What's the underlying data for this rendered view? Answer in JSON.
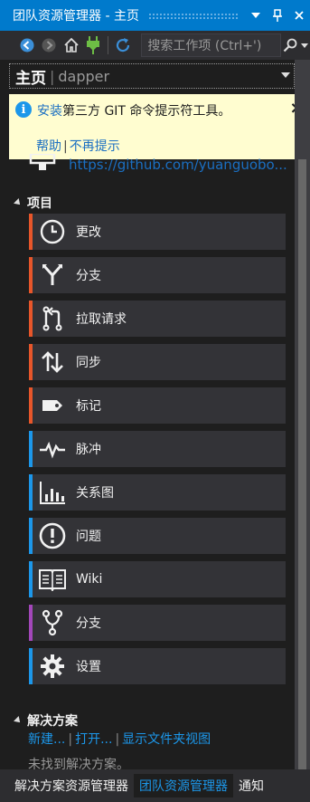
{
  "window": {
    "title": "团队资源管理器 - 主页",
    "dropdown_icon": "window-menu-icon",
    "pin_icon": "pin-icon",
    "close_icon": "close-icon"
  },
  "toolbar": {
    "search_placeholder": "搜索工作项 (Ctrl+')",
    "buttons": [
      "back-icon",
      "forward-icon",
      "home-icon",
      "connect-icon",
      "refresh-icon",
      "search-icon"
    ]
  },
  "page": {
    "title": "主页",
    "separator": "|",
    "repository": "dapper"
  },
  "infobar": {
    "link_install": "安装",
    "message": "第三方 GIT 命令提示符工具。",
    "close": "×",
    "help": "帮助",
    "separator": "|",
    "dont_show": "不再提示"
  },
  "connect": {
    "url": "https://github.com/yuanguobo..."
  },
  "project_section": {
    "title": "项目",
    "tiles": [
      {
        "label": "更改",
        "icon": "clock-icon",
        "color": "#e8562a"
      },
      {
        "label": "分支",
        "icon": "branch-icon",
        "color": "#e8562a"
      },
      {
        "label": "拉取请求",
        "icon": "pull-request-icon",
        "color": "#e8562a"
      },
      {
        "label": "同步",
        "icon": "sync-arrows-icon",
        "color": "#e8562a"
      },
      {
        "label": "标记",
        "icon": "tag-icon",
        "color": "#e8562a"
      },
      {
        "label": "脉冲",
        "icon": "pulse-icon",
        "color": "#1c97ea"
      },
      {
        "label": "关系图",
        "icon": "chart-icon",
        "color": "#1c97ea"
      },
      {
        "label": "问题",
        "icon": "issue-icon",
        "color": "#1c97ea"
      },
      {
        "label": "Wiki",
        "icon": "book-icon",
        "color": "#1c97ea"
      },
      {
        "label": "分支",
        "icon": "fork-icon",
        "color": "#a347ba"
      },
      {
        "label": "设置",
        "icon": "gear-icon",
        "color": "#1c97ea"
      }
    ]
  },
  "solutions_section": {
    "title": "解决方案",
    "new_link": "新建...",
    "open_link": "打开...",
    "folder_view_link": "显示文件夹视图",
    "separator": "|",
    "status": "未找到解决方案。"
  },
  "bottom_tabs": [
    "解决方案资源管理器",
    "团队资源管理器",
    "通知"
  ],
  "active_tab": "团队资源管理器"
}
